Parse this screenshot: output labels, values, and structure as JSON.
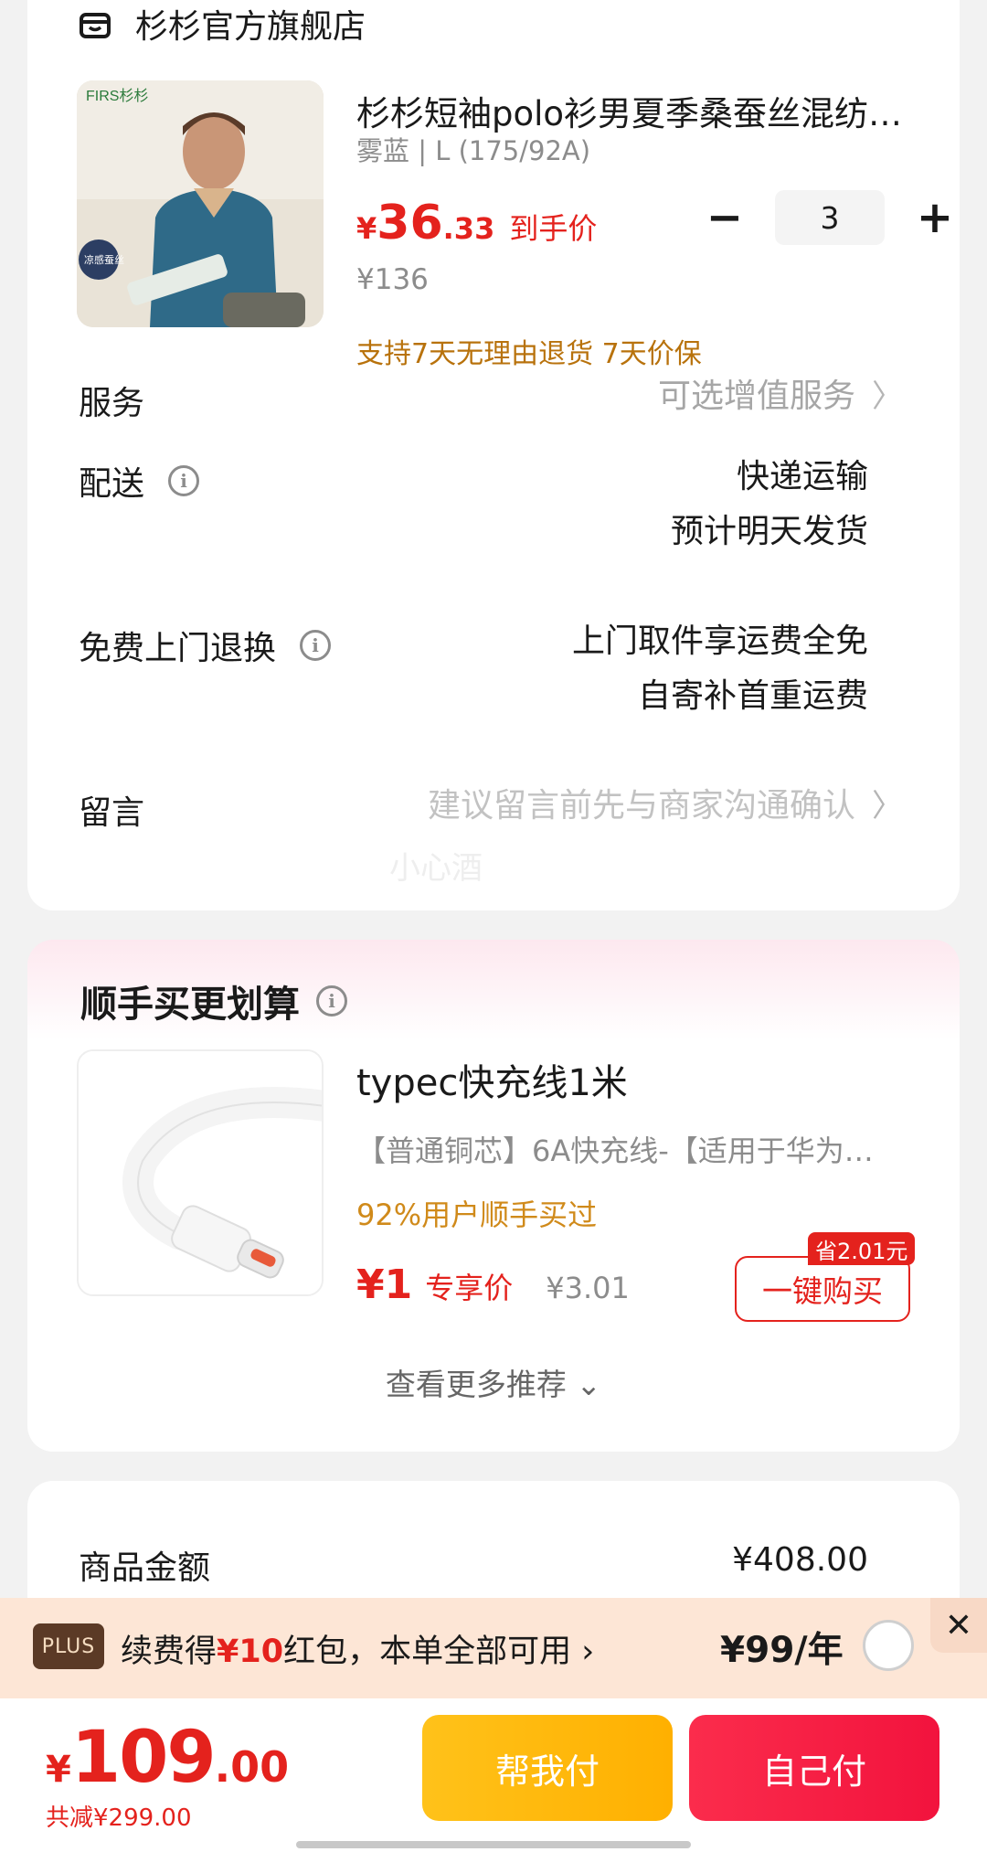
{
  "store": {
    "name": "杉杉官方旗舰店",
    "product": {
      "title": "杉杉短袖polo衫男夏季桑蚕丝混纺商务休闲",
      "spec": "雾蓝 | L (175/92A)",
      "price_yen": "¥",
      "price_int": "36",
      "price_dec": ".33",
      "price_tag": "到手价",
      "original_price": "¥136",
      "quantity": "3",
      "minus": "−",
      "plus": "+",
      "guarantee": "支持7天无理由退货  7天价保",
      "image_brand": "FIRS杉杉",
      "image_badge": "凉感蚕丝"
    },
    "rows": {
      "service_label": "服务",
      "service_value": "可选增值服务",
      "delivery_label": "配送",
      "delivery_line1": "快递运输",
      "delivery_line2": "预计明天发货",
      "return_label": "免费上门退换",
      "return_line1": "上门取件享运费全免",
      "return_line2": "自寄补首重运费",
      "message_label": "留言",
      "message_placeholder": "建议留言前先与商家沟通确认",
      "watermark": "小心酒"
    }
  },
  "addon": {
    "title": "顺手买更划算",
    "name": "typec快充线1米",
    "desc": "【普通铜芯】6A快充线-【适用于华为…",
    "social": "92%用户顺手买过",
    "price": "¥1",
    "price_label": "专享价",
    "original_price": "¥3.01",
    "save_badge": "省2.01元",
    "buy_label": "一键购买",
    "more": "查看更多推荐 ⌄"
  },
  "summary": {
    "goods_label": "商品金额",
    "goods_value": "¥408.00"
  },
  "plus_bar": {
    "badge": "PLUS",
    "text_pre": "续费得",
    "text_hl": "¥10",
    "text_post": "红包，本单全部可用 ›",
    "price": "¥99/年",
    "close": "✕"
  },
  "footer": {
    "yen": "¥",
    "total_int": "109",
    "total_dec": ".00",
    "discount": "共减¥299.00",
    "help_pay": "帮我付",
    "self_pay": "自己付"
  },
  "colors": {
    "accent_red": "#e4221d",
    "gold": "#b8720c",
    "help_yellow": "#ffb800",
    "pay_red": "#f2133d"
  }
}
